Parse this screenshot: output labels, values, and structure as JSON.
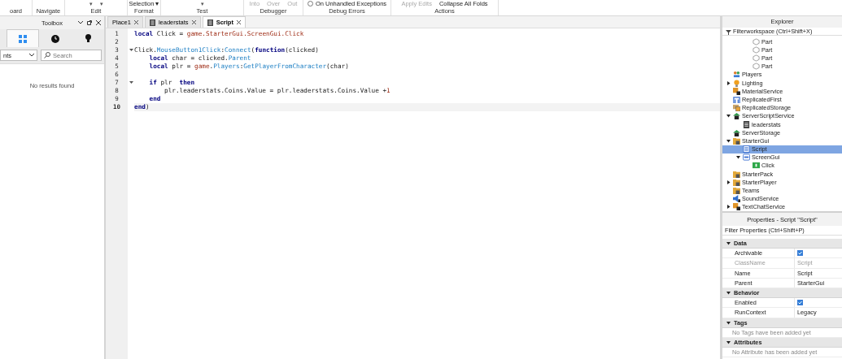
{
  "ribbon": {
    "groups": [
      {
        "label": "oard"
      },
      {
        "label": "Navigate"
      },
      {
        "label": "Edit",
        "items": [
          {
            "kind": "caret",
            "text": "▾"
          },
          {
            "kind": "caret",
            "text": "▾"
          }
        ]
      },
      {
        "label": "Format",
        "items": [
          {
            "kind": "dropdown",
            "text": "Selection",
            "caret": "▾"
          }
        ]
      },
      {
        "label": "Test",
        "items": [
          {
            "kind": "caret",
            "text": "▾"
          }
        ]
      },
      {
        "label": "Debugger",
        "items": [
          {
            "kind": "button",
            "text": "Into",
            "disabled": true
          },
          {
            "kind": "button",
            "text": "Over",
            "disabled": true
          },
          {
            "kind": "button",
            "text": "Out",
            "disabled": true
          }
        ]
      },
      {
        "label": "Debug Errors",
        "items": [
          {
            "kind": "radio",
            "text": "On Unhandled Exceptions",
            "checked": false
          }
        ]
      },
      {
        "label": "Actions",
        "items": [
          {
            "kind": "button",
            "text": "Apply Edits",
            "disabled": true
          },
          {
            "kind": "button",
            "text": "Collapse All Folds",
            "disabled": false
          }
        ]
      }
    ]
  },
  "toolbox": {
    "title": "Toolbox",
    "tabs": [
      {
        "kind": "grid",
        "selected": true
      },
      {
        "kind": "clock",
        "selected": false
      },
      {
        "kind": "bulb",
        "selected": false
      }
    ],
    "category": "nts",
    "search": {
      "placeholder": "Search"
    },
    "message": "No results found"
  },
  "editor": {
    "tabs": [
      {
        "label": "Place1",
        "kind": "place",
        "selected": false
      },
      {
        "label": "leaderstats",
        "kind": "script",
        "selected": false
      },
      {
        "label": "Script",
        "kind": "script",
        "selected": true
      }
    ],
    "lines": [
      {
        "number": "1",
        "foldable": false,
        "current": false,
        "tokens": [
          {
            "kind": "keyword",
            "text": "local"
          },
          {
            "kind": "plain",
            "text": " Click = "
          },
          {
            "kind": "global",
            "text": "game.StarterGui.ScreenGui.Click"
          }
        ]
      },
      {
        "number": "2",
        "foldable": false,
        "current": false
      },
      {
        "number": "3",
        "foldable": true,
        "current": false,
        "tokens": [
          {
            "kind": "plain",
            "text": "Click."
          },
          {
            "kind": "member",
            "text": "MouseButton1Click"
          },
          {
            "kind": "plain",
            "text": ":"
          },
          {
            "kind": "member",
            "text": "Connect"
          },
          {
            "kind": "plain",
            "text": "("
          },
          {
            "kind": "keyword",
            "text": "function"
          },
          {
            "kind": "plain",
            "text": "(clicked)"
          }
        ]
      },
      {
        "number": "4",
        "foldable": false,
        "current": false,
        "tokens": [
          {
            "kind": "keyword",
            "text": "    local"
          },
          {
            "kind": "plain",
            "text": " char = clicked."
          },
          {
            "kind": "member",
            "text": "Parent"
          }
        ]
      },
      {
        "number": "5",
        "foldable": false,
        "current": false,
        "tokens": [
          {
            "kind": "keyword",
            "text": "    local"
          },
          {
            "kind": "plain",
            "text": " plr = "
          },
          {
            "kind": "global",
            "text": "game"
          },
          {
            "kind": "plain",
            "text": "."
          },
          {
            "kind": "member",
            "text": "Players"
          },
          {
            "kind": "plain",
            "text": ":"
          },
          {
            "kind": "member",
            "text": "GetPlayerFromCharacter"
          },
          {
            "kind": "plain",
            "text": "(char)"
          }
        ]
      },
      {
        "number": "6",
        "foldable": false,
        "current": false
      },
      {
        "number": "7",
        "foldable": true,
        "current": false,
        "tokens": [
          {
            "kind": "keyword",
            "text": "    if"
          },
          {
            "kind": "plain",
            "text": " plr  "
          },
          {
            "kind": "keyword",
            "text": "then"
          }
        ]
      },
      {
        "number": "8",
        "foldable": false,
        "current": false,
        "tokens": [
          {
            "kind": "plain",
            "text": "        plr.leaderstats.Coins.Value = plr.leaderstats.Coins.Value +"
          },
          {
            "kind": "number",
            "text": "1"
          }
        ]
      },
      {
        "number": "9",
        "foldable": false,
        "current": false,
        "tokens": [
          {
            "kind": "keyword",
            "text": "    end"
          }
        ]
      },
      {
        "number": "10",
        "foldable": false,
        "current": true,
        "tokens": [
          {
            "kind": "keyword",
            "text": "end"
          },
          {
            "kind": "plain",
            "text": ")"
          }
        ]
      }
    ]
  },
  "explorer": {
    "title": "Explorer",
    "filter": {
      "placeholder": "Filterworkspace (Ctrl+Shift+X)"
    },
    "tree": [
      {
        "children": [
          {
            "label": "Part",
            "kind": "part",
            "selected": false
          },
          {
            "label": "Part",
            "kind": "part",
            "selected": false
          },
          {
            "label": "Part",
            "kind": "part",
            "selected": false
          },
          {
            "label": "Part",
            "kind": "part",
            "selected": false
          }
        ]
      },
      {
        "label": "Players",
        "kind": "players",
        "selected": false
      },
      {
        "label": "Lighting",
        "kind": "lighting",
        "selected": false,
        "expanded": false
      },
      {
        "label": "MaterialService",
        "kind": "service",
        "selected": false
      },
      {
        "label": "ReplicatedFirst",
        "kind": "first",
        "selected": false
      },
      {
        "label": "ReplicatedStorage",
        "kind": "storage",
        "selected": false
      },
      {
        "label": "ServerScriptService",
        "kind": "server",
        "selected": false,
        "expanded": true,
        "children": [
          {
            "label": "leaderstats",
            "kind": "script",
            "selected": false
          }
        ]
      },
      {
        "label": "ServerStorage",
        "kind": "server",
        "selected": false
      },
      {
        "label": "StarterGui",
        "kind": "folder",
        "selected": false,
        "expanded": true,
        "children": [
          {
            "label": "Script",
            "kind": "localscript",
            "selected": true
          },
          {
            "label": "ScreenGui",
            "kind": "gui",
            "selected": false,
            "expanded": true,
            "children": [
              {
                "label": "Click",
                "kind": "button",
                "selected": false
              }
            ]
          }
        ]
      },
      {
        "label": "StarterPack",
        "kind": "folder",
        "selected": false
      },
      {
        "label": "StarterPlayer",
        "kind": "folder",
        "selected": false,
        "expanded": false
      },
      {
        "label": "Teams",
        "kind": "folder",
        "selected": false
      },
      {
        "label": "SoundService",
        "kind": "sound",
        "selected": false
      },
      {
        "label": "TextChatService",
        "kind": "service",
        "selected": false,
        "expanded": false
      }
    ]
  },
  "properties": {
    "title": "Properties - Script \"Script\"",
    "filter": {
      "placeholder": "Filter Properties (Ctrl+Shift+P)"
    },
    "sections": [
      {
        "title": "Data",
        "expanded": true,
        "rows": [
          {
            "kind": "checkbox",
            "name": "Archivable",
            "checked": true,
            "disabled": false
          },
          {
            "kind": "text",
            "name": "ClassName",
            "value": "Script",
            "disabled": true
          },
          {
            "kind": "text",
            "name": "Name",
            "value": "Script",
            "disabled": false
          },
          {
            "kind": "text",
            "name": "Parent",
            "value": "StarterGui",
            "disabled": false
          }
        ]
      },
      {
        "title": "Behavior",
        "expanded": true,
        "rows": [
          {
            "kind": "checkbox",
            "name": "Enabled",
            "checked": true,
            "disabled": false
          },
          {
            "kind": "text",
            "name": "RunContext",
            "value": "Legacy",
            "disabled": false
          }
        ]
      },
      {
        "title": "Tags",
        "expanded": true,
        "note": "No Tags have been added yet"
      },
      {
        "title": "Attributes",
        "expanded": true,
        "note": "No Attribute has been added yet"
      }
    ]
  }
}
